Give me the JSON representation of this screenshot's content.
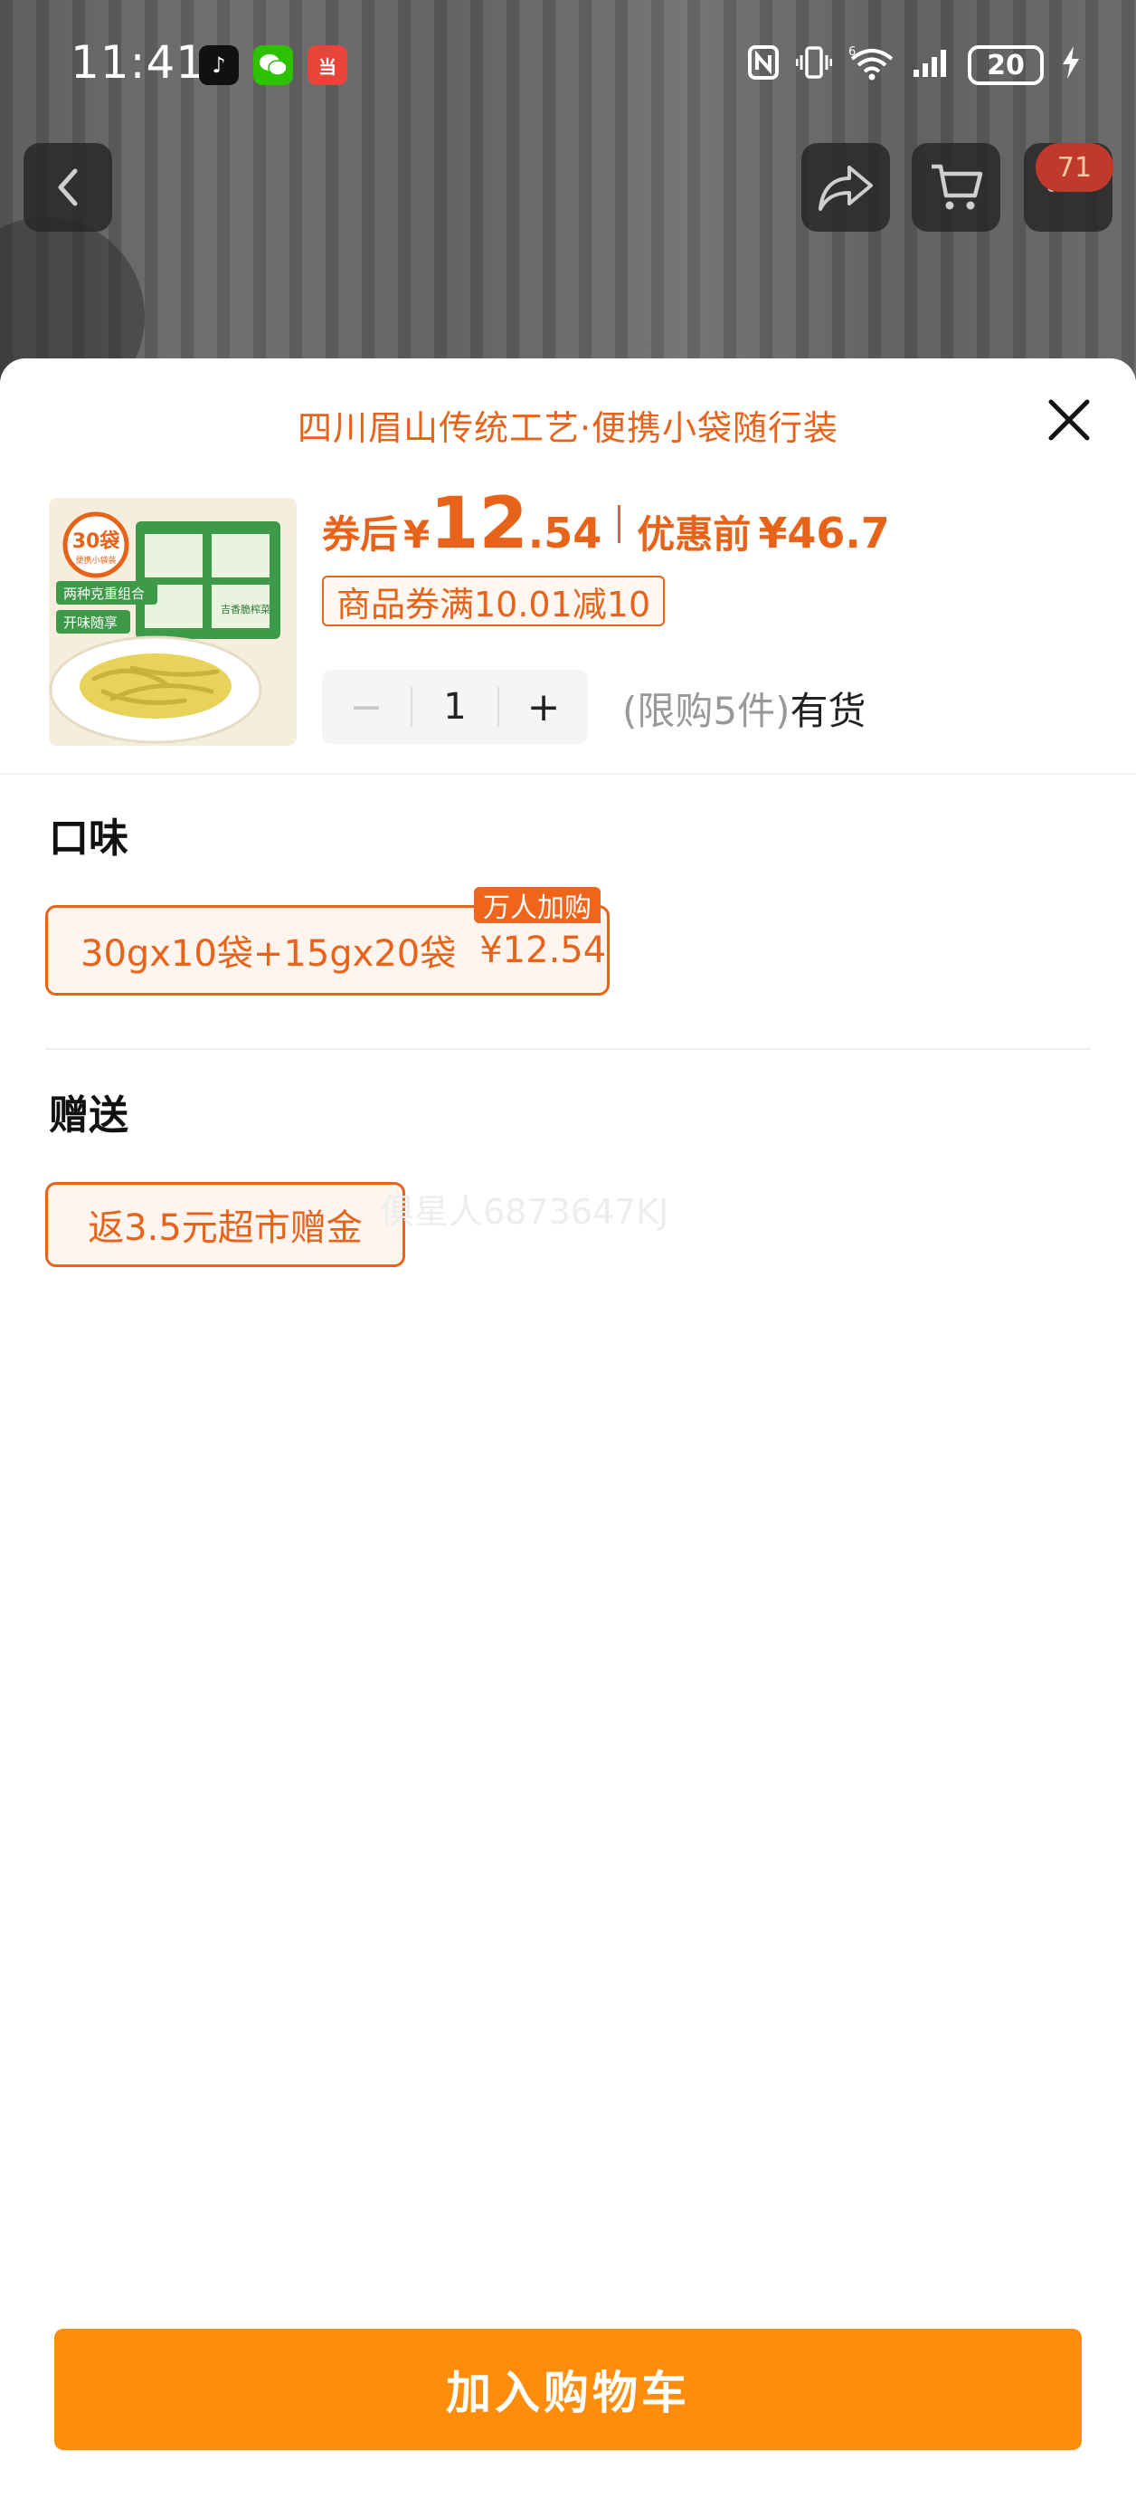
{
  "status_bar": {
    "time": "11:41",
    "battery": "20",
    "app_icons": [
      "tiktok-icon",
      "wechat-icon",
      "dangdang-icon"
    ],
    "right_icons": [
      "nfc-icon",
      "vibrate-icon",
      "wifi-6-icon",
      "signal-icon",
      "battery-icon",
      "charging-icon"
    ]
  },
  "nav": {
    "cart_badge": "71"
  },
  "sheet": {
    "title": "四川眉山传统工艺·便携小袋随行装",
    "price": {
      "prefix": "券后",
      "currency": "¥",
      "integer": "12",
      "decimal": ".54",
      "original_label": "优惠前",
      "original_price": "¥46.7"
    },
    "coupon": "商品券满10.01减10",
    "thumbnail": {
      "badge_text": "30袋",
      "badge_sub": "便携小袋装",
      "bullet_1": "两种克重组合",
      "bullet_2": "开味随享",
      "pack_label": "吉香脆榨菜"
    },
    "quantity": {
      "minus": "−",
      "value": "1",
      "plus": "+"
    },
    "stock": {
      "limit": "(限购5件)",
      "status": "有货"
    },
    "flavor": {
      "title": "口味",
      "option_label": "30gx10袋+15gx20袋",
      "option_price": "¥12.54",
      "option_badge": "万人加购"
    },
    "gift": {
      "title": "赠送",
      "option_label": "返3.5元超市赠金",
      "watermark": "俱星人6873647KJ"
    },
    "add_to_cart": "加入购物车"
  },
  "colors": {
    "accent": "#e8631a",
    "button": "#ff8c0a",
    "badge": "#f0641c"
  }
}
